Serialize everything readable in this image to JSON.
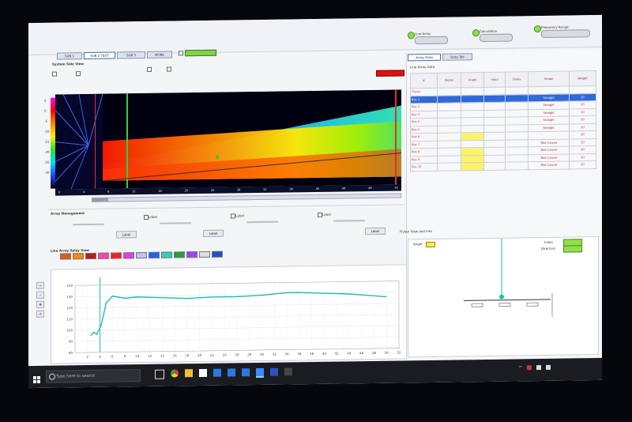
{
  "tabs": [
    "SUB 1",
    "SUB 2 TEXT",
    "SUB 3",
    "MORE"
  ],
  "tab_active_index": 1,
  "status_pills": [
    {
      "label": "Line Array"
    },
    {
      "label": "Calculation"
    },
    {
      "label": "Frequency Range"
    }
  ],
  "side_view": {
    "title": "System Side View",
    "label_top": "",
    "top_right_hint": "",
    "db_scale": [
      "5",
      "0",
      "-5",
      "-10",
      "-15",
      "-20",
      "-25",
      "-30",
      "-35"
    ]
  },
  "heat_axis_ticks": [
    "0",
    "2",
    "4",
    "6",
    "8",
    "10",
    "12",
    "14",
    "16",
    "18",
    "20",
    "22",
    "24",
    "26",
    "28",
    "30",
    "32",
    "34",
    "36",
    "38",
    "40",
    "42",
    "44",
    "46",
    "48",
    "50",
    "52",
    "54"
  ],
  "array_mgmt": {
    "title": "Array Management",
    "checks": [
      "Label",
      "Label",
      "Label"
    ],
    "buttons": [
      "Label",
      "Label",
      "Label"
    ]
  },
  "splay": {
    "title": "Line Array Splay View"
  },
  "right_tabs": [
    "Array Data",
    "Data Tab"
  ],
  "table": {
    "title": "Line Array Data",
    "headers": [
      "#",
      "Model",
      "Angle",
      "Input",
      "Delay",
      "Shape",
      "Weight"
    ],
    "rows": [
      {
        "id": "Flybar",
        "model": "",
        "angle": "",
        "input": "",
        "delay": "",
        "shape": "",
        "weight": ""
      },
      {
        "id": "Box 1",
        "model": "",
        "angle": "",
        "input": "",
        "delay": "",
        "shape": "Straight",
        "weight": "20"
      },
      {
        "id": "Box 2",
        "model": "",
        "angle": "",
        "input": "",
        "delay": "",
        "shape": "Straight",
        "weight": "20"
      },
      {
        "id": "Box 3",
        "model": "",
        "angle": "",
        "input": "",
        "delay": "",
        "shape": "Straight",
        "weight": "20"
      },
      {
        "id": "Box 4",
        "model": "",
        "angle": "",
        "input": "",
        "delay": "",
        "shape": "Straight",
        "weight": "20"
      },
      {
        "id": "Box 5",
        "model": "",
        "angle": "",
        "input": "",
        "delay": "",
        "shape": "Straight",
        "weight": "20"
      },
      {
        "id": "Box 6",
        "model": "",
        "angle": "",
        "input": "",
        "delay": "",
        "shape": "",
        "weight": "20"
      },
      {
        "id": "Box 7",
        "model": "",
        "angle": "",
        "input": "",
        "delay": "",
        "shape": "Mid Curved",
        "weight": "20"
      },
      {
        "id": "Box 8",
        "model": "",
        "angle": "",
        "input": "",
        "delay": "",
        "shape": "Mid Curved",
        "weight": "20"
      },
      {
        "id": "Box 9",
        "model": "",
        "angle": "",
        "input": "",
        "delay": "",
        "shape": "Mid Curved",
        "weight": "20"
      },
      {
        "id": "Box 10",
        "model": "",
        "angle": "",
        "input": "",
        "delay": "",
        "shape": "Mid Curved",
        "weight": "20"
      }
    ],
    "selected_row": 1,
    "yellow_rows": [
      6,
      8,
      9,
      10
    ]
  },
  "flybar": {
    "title": "Flybar View and Info",
    "angle_label": "Angle",
    "angle_value": "",
    "info1_label": "Index",
    "info1_value": "",
    "info2_label": "Direction",
    "info2_value": ""
  },
  "spl_chart": {
    "y_ticks": [
      "140",
      "130",
      "120",
      "110",
      "100",
      "90",
      "80"
    ],
    "x_ticks": [
      "2",
      "4",
      "6",
      "8",
      "10",
      "12",
      "14",
      "16",
      "18",
      "20",
      "22",
      "24",
      "26",
      "28",
      "30",
      "32",
      "34",
      "36",
      "38",
      "40",
      "42",
      "44",
      "46",
      "48",
      "50",
      "52"
    ]
  },
  "taskbar": {
    "search_placeholder": "Type here to search",
    "time": "",
    "date": ""
  },
  "colors": {
    "accent": "#2f68d8",
    "spl_line": "#1fbfa8",
    "status_green": "#8fe04a"
  },
  "chart_data": {
    "type": "line",
    "x": [
      2.5,
      3,
      3.5,
      3.8,
      4.2,
      5,
      6,
      8,
      10,
      14,
      18,
      22,
      26,
      30,
      34,
      36,
      40,
      44,
      48,
      50
    ],
    "values": [
      95,
      98,
      96,
      100,
      104,
      124,
      130,
      128,
      129,
      128,
      127,
      128,
      128,
      129,
      131,
      131,
      130,
      129,
      127,
      126
    ],
    "ylim": [
      80,
      140
    ],
    "xlim": [
      0,
      52
    ]
  }
}
